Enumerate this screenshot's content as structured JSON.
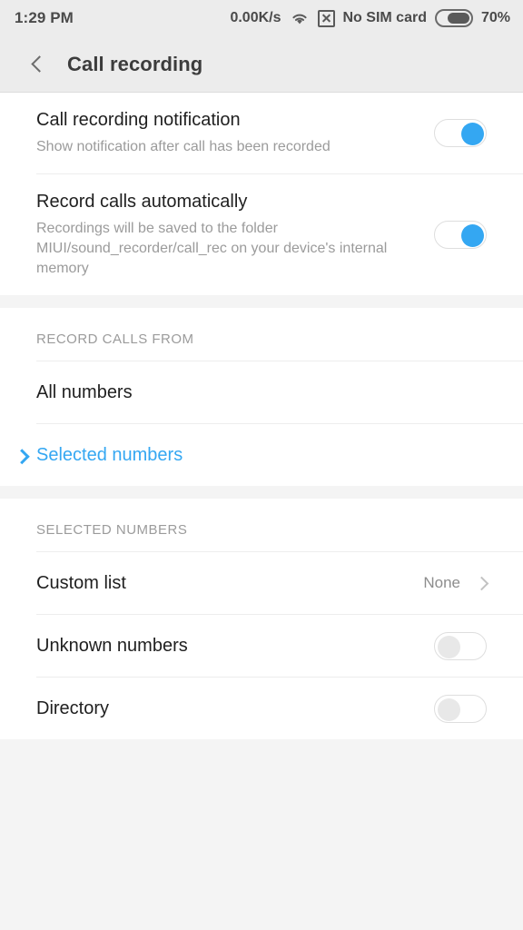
{
  "status_bar": {
    "time": "1:29 PM",
    "network_speed": "0.00K/s",
    "wifi_icon": "wifi-icon",
    "sim_icon": "sim-card-x-icon",
    "sim_text": "No SIM card",
    "battery_icon": "battery-icon",
    "battery_percent": "70%"
  },
  "app_bar": {
    "back_icon": "back-chevron-icon",
    "title": "Call recording"
  },
  "settings": {
    "call_recording_notification": {
      "title": "Call recording notification",
      "subtitle": "Show notification after call has been recorded",
      "toggle_state": "on"
    },
    "record_calls_automatically": {
      "title": "Record calls automatically",
      "subtitle": "Recordings will be saved to the folder MIUI/sound_recorder/call_rec on your device's internal memory",
      "toggle_state": "on"
    }
  },
  "record_calls_from": {
    "header": "RECORD CALLS FROM",
    "options": [
      {
        "label": "All numbers",
        "selected": false
      },
      {
        "label": "Selected numbers",
        "selected": true
      }
    ]
  },
  "selected_numbers": {
    "header": "SELECTED NUMBERS",
    "custom_list": {
      "label": "Custom list",
      "value": "None",
      "chevron_icon": "chevron-right-icon"
    },
    "unknown_numbers": {
      "label": "Unknown numbers",
      "toggle_state": "off"
    },
    "directory": {
      "label": "Directory",
      "toggle_state": "off"
    }
  },
  "colors": {
    "accent": "#34a7f2",
    "header_bg": "#ececec",
    "page_bg": "#f4f4f4",
    "text_primary": "#1f1f1f",
    "text_secondary": "#9b9b9b"
  }
}
